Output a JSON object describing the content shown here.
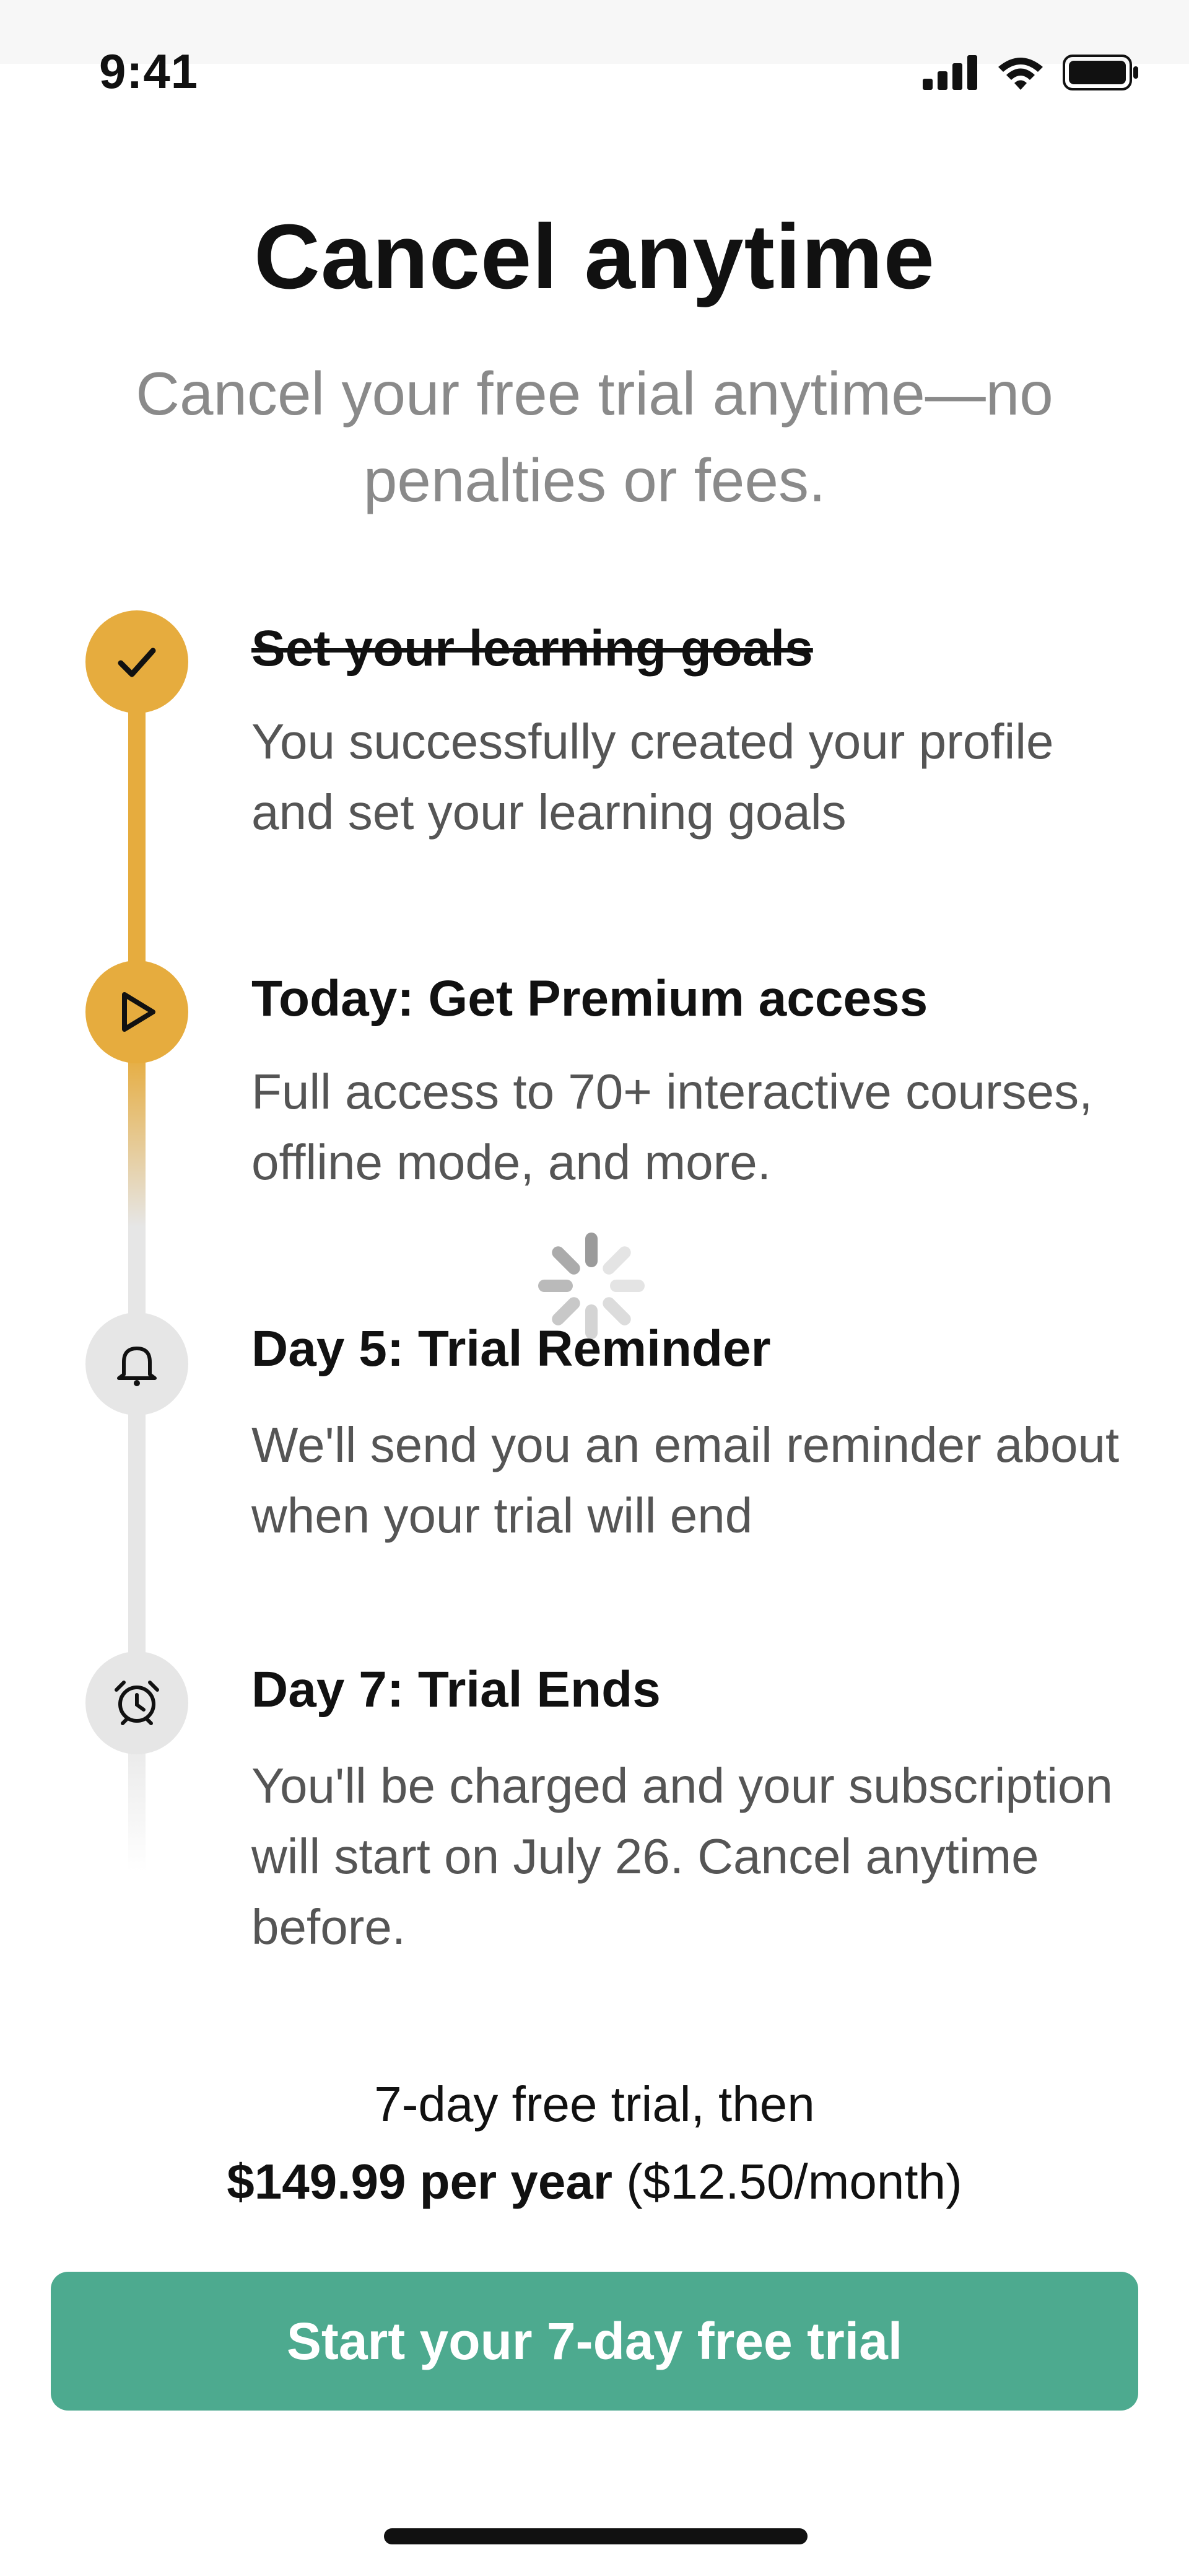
{
  "status_bar": {
    "time": "9:41",
    "icons": [
      "cellular-signal-icon",
      "wifi-icon",
      "battery-icon"
    ]
  },
  "header": {
    "title": "Cancel anytime",
    "subtitle": "Cancel your free trial anytime—no penalties or fees."
  },
  "timeline": {
    "steps": [
      {
        "title": "Set your learning goals",
        "description": "You successfully created your profile and set your learning goals",
        "icon": "checkmark-icon",
        "state": "completed"
      },
      {
        "title": "Today: Get Premium access",
        "description": "Full access to 70+ interactive courses, offline mode, and more.",
        "icon": "play-icon",
        "state": "current"
      },
      {
        "title": "Day 5: Trial Reminder",
        "description": "We'll send you an email reminder about when your trial will end",
        "icon": "bell-icon",
        "state": "upcoming"
      },
      {
        "title": "Day 7: Trial Ends",
        "description": "You'll be charged and your subscription will start on July 26. Cancel anytime before.",
        "icon": "alarm-clock-icon",
        "state": "upcoming"
      }
    ]
  },
  "pricing": {
    "line1": "7-day free trial, then",
    "price_bold": "$149.99 per year",
    "price_monthly": " ($12.50/month)"
  },
  "cta": {
    "label": "Start your 7-day free trial"
  },
  "colors": {
    "accent_gold": "#e6ac3e",
    "cta_green": "#4daa8f",
    "track_grey": "#e6e6e6",
    "subtitle_grey": "#8a8a8a"
  }
}
